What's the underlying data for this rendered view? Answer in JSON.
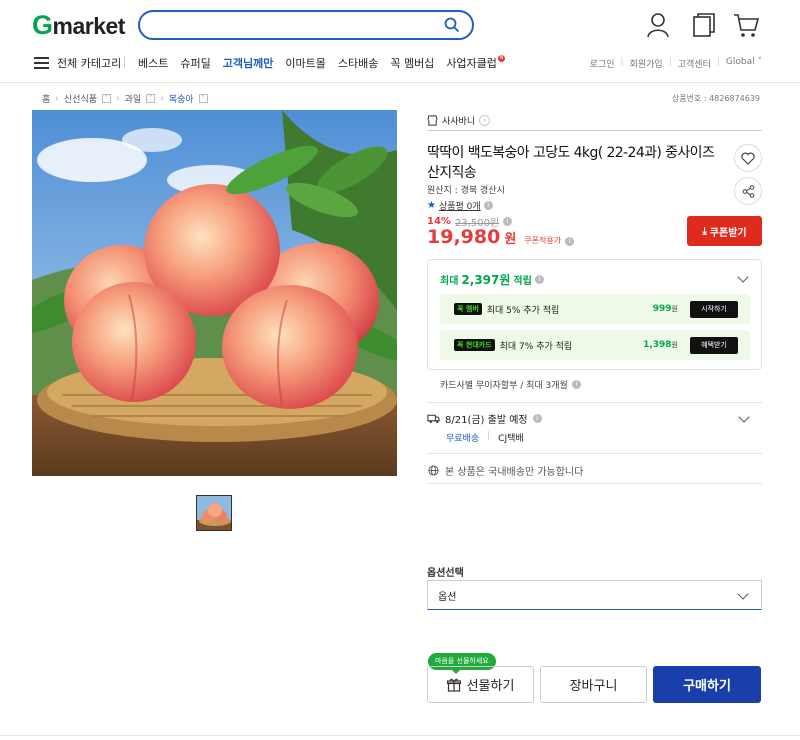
{
  "header": {
    "logo_g": "G",
    "logo_rest": "market",
    "search": {
      "value": "",
      "placeholder": ""
    },
    "icons": [
      "user-icon",
      "recent-view-icon",
      "cart-icon"
    ]
  },
  "nav": {
    "all_categories": "전체 카테고리",
    "links": [
      "베스트",
      "슈퍼딜",
      "고객님께만",
      "이마트몰",
      "스타배송",
      "꼭 멤버십",
      "사업자클럽"
    ],
    "new_badge": "N",
    "util": [
      "로그인",
      "회원가입",
      "고객센터",
      "Global"
    ]
  },
  "breadcrumb": [
    "홈",
    "신선식품",
    "과일",
    "복숭아"
  ],
  "product_no": "상품번호 : 4826874639",
  "seller": "사사바니",
  "product": {
    "title": "딱딱이 백도복숭아 고당도 4kg( 22-24과) 중사이즈 산지직송",
    "origin": "원산지 : 경북 경산시",
    "review": "상품평 0개",
    "discount_pct": "14%",
    "original_price": "23,500원",
    "price": "19,980",
    "price_unit": "원",
    "price_label": "쿠폰적용가",
    "coupon_button": "쿠폰받기"
  },
  "points": {
    "head_prefix": "최대",
    "head_amount": "2,397원",
    "head_suffix": "적립",
    "rows": [
      {
        "badge": "꼭 멤버",
        "text": "최대 5% 추가 적립",
        "amount": "999",
        "unit": "원",
        "button": "시작하기"
      },
      {
        "badge": "꼭 현대카드",
        "text": "최대 7% 추가 적립",
        "amount": "1,398",
        "unit": "원",
        "button": "혜택받기"
      }
    ]
  },
  "installment": "카드사별 무이자할부 / 최대 3개월",
  "shipping": {
    "date": "8/21(금) 출발 예정",
    "fee": "무료배송",
    "carrier": "CJ택배"
  },
  "domestic_note": "본 상품은 국내배송만 가능합니다",
  "option": {
    "label": "옵션선택",
    "value": "옵션"
  },
  "actions": {
    "gift_tip": "마음을 선물하세요",
    "gift": "선물하기",
    "cart": "장바구니",
    "buy": "구매하기"
  },
  "colors": {
    "accent_blue": "#1e5fbf",
    "price_red": "#e53b3b",
    "point_green": "#00a650",
    "buy_navy": "#1a3faa"
  }
}
